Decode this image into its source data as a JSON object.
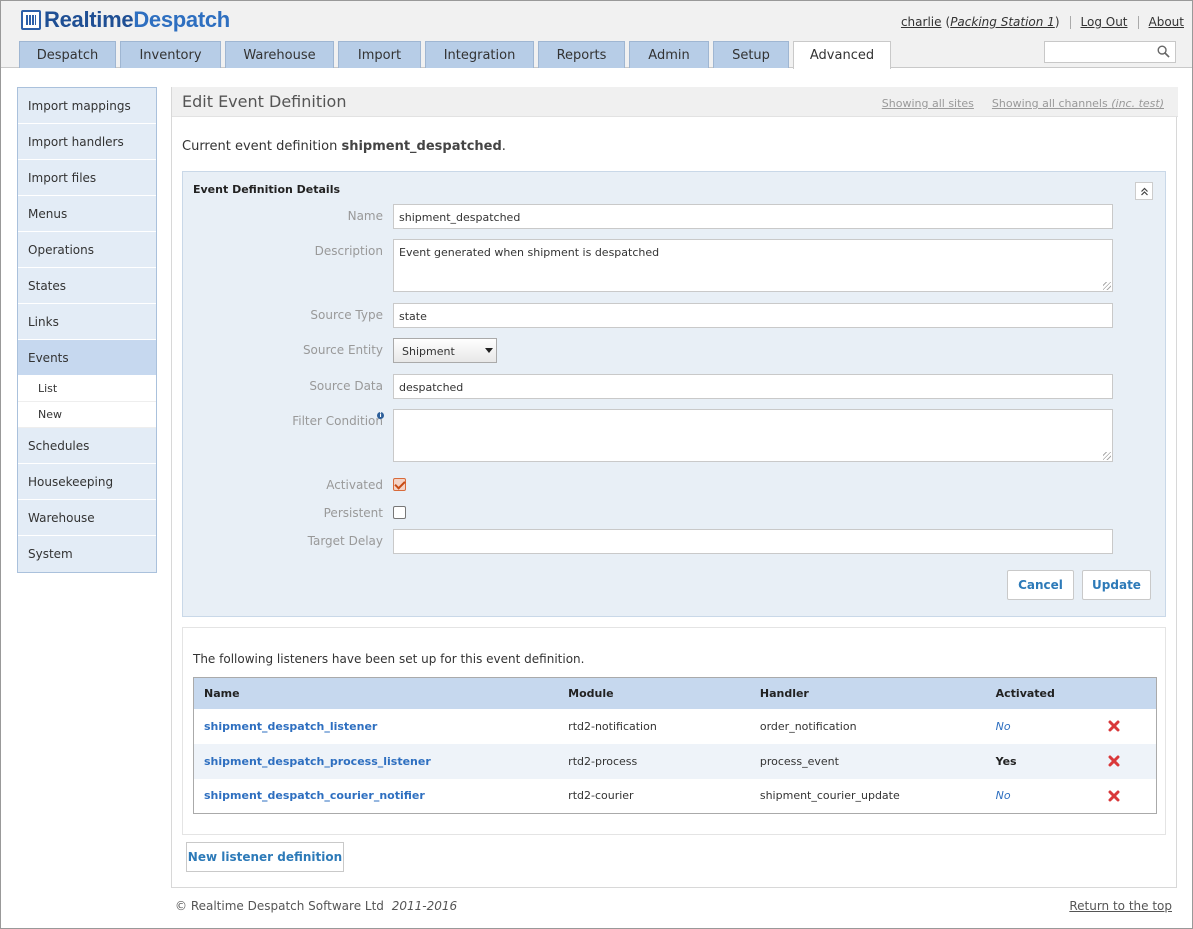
{
  "brand": {
    "name_part1": "Realtime",
    "name_part2": "Despatch"
  },
  "user": {
    "name": "charlie",
    "station_prefix": "(",
    "station": "Packing Station 1",
    "station_suffix": ")",
    "logout": "Log Out",
    "about": "About"
  },
  "tabs": [
    {
      "label": "Despatch"
    },
    {
      "label": "Inventory"
    },
    {
      "label": "Warehouse"
    },
    {
      "label": "Import"
    },
    {
      "label": "Integration"
    },
    {
      "label": "Reports"
    },
    {
      "label": "Admin"
    },
    {
      "label": "Setup"
    },
    {
      "label": "Advanced",
      "active": true
    }
  ],
  "search": {
    "placeholder": ""
  },
  "sidebar": {
    "items": [
      {
        "label": "Import mappings"
      },
      {
        "label": "Import handlers"
      },
      {
        "label": "Import files"
      },
      {
        "label": "Menus"
      },
      {
        "label": "Operations"
      },
      {
        "label": "States"
      },
      {
        "label": "Links"
      },
      {
        "label": "Events",
        "active": true
      },
      {
        "label": "Schedules"
      },
      {
        "label": "Housekeeping"
      },
      {
        "label": "Warehouse"
      },
      {
        "label": "System"
      }
    ],
    "sub": [
      {
        "label": "List"
      },
      {
        "label": "New"
      }
    ]
  },
  "page": {
    "title": "Edit Event Definition",
    "showing_sites": "Showing all sites",
    "showing_channels": "Showing all channels",
    "showing_channels_note": "(inc. test)",
    "current_prefix": "Current event definition",
    "current_name": "shipment_despatched",
    "current_suffix": "."
  },
  "form": {
    "panel_title": "Event Definition Details",
    "collapse_icon": "double-chevron-up-icon",
    "fields": {
      "name": {
        "label": "Name",
        "value": "shipment_despatched"
      },
      "description": {
        "label": "Description",
        "value": "Event generated when shipment is despatched"
      },
      "source_type": {
        "label": "Source Type",
        "value": "state"
      },
      "source_entity": {
        "label": "Source Entity",
        "value": "Shipment"
      },
      "source_data": {
        "label": "Source Data",
        "value": "despatched"
      },
      "filter_condition": {
        "label": "Filter Condition",
        "value": ""
      },
      "activated": {
        "label": "Activated",
        "checked": true
      },
      "persistent": {
        "label": "Persistent",
        "checked": false
      },
      "target_delay": {
        "label": "Target Delay",
        "value": ""
      }
    },
    "cancel": "Cancel",
    "update": "Update"
  },
  "listeners": {
    "intro": "The following listeners have been set up for this event definition.",
    "columns": {
      "name": "Name",
      "module": "Module",
      "handler": "Handler",
      "activated": "Activated"
    },
    "rows": [
      {
        "name": "shipment_despatch_listener",
        "module": "rtd2-notification",
        "handler": "order_notification",
        "activated": "No"
      },
      {
        "name": "shipment_despatch_process_listener",
        "module": "rtd2-process",
        "handler": "process_event",
        "activated": "Yes"
      },
      {
        "name": "shipment_despatch_courier_notifier",
        "module": "rtd2-courier",
        "handler": "shipment_courier_update",
        "activated": "No"
      }
    ],
    "new_button": "New listener definition"
  },
  "footer": {
    "copyright": "© Realtime Despatch Software Ltd",
    "years": "2011-2016",
    "return_top": "Return to the top"
  },
  "colors": {
    "tab_bg": "#b7cde7",
    "accent": "#2e6fc0",
    "panel_bg": "#e8eff6",
    "delete": "#d9383a"
  }
}
